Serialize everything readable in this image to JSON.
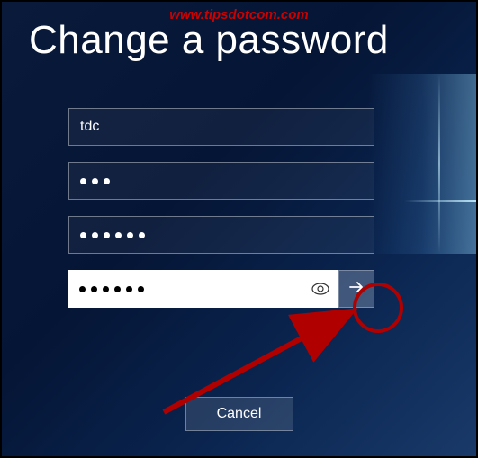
{
  "watermark": "www.tipsdotcom.com",
  "title": "Change a password",
  "username": "tdc",
  "old_password_dots": 3,
  "new_password_dots": 6,
  "confirm_password_dots": 6,
  "cancel_label": "Cancel"
}
